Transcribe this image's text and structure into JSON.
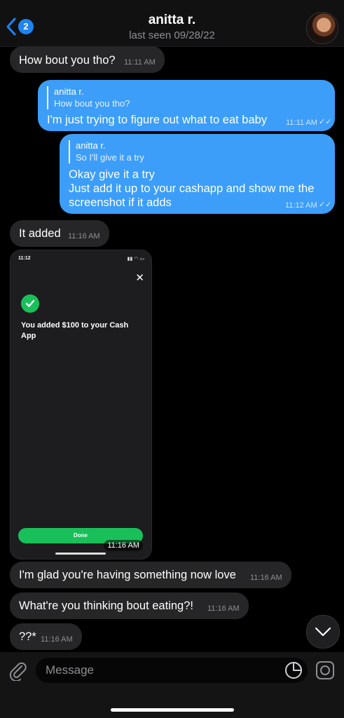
{
  "header": {
    "back_badge": "2",
    "contact_name": "anitta r.",
    "last_seen": "last seen 09/28/22"
  },
  "messages": [
    {
      "dir": "in",
      "text": "How bout you tho?",
      "time": "11:11 AM"
    },
    {
      "dir": "out",
      "reply_name": "anitta r.",
      "reply_text": "How bout you tho?",
      "text": "I'm just trying to figure out what to eat baby",
      "time": "11:11 AM"
    },
    {
      "dir": "out",
      "reply_name": "anitta r.",
      "reply_text": "So I'll give it a try",
      "lines": [
        "Okay give it a try",
        "Just add it up to your cashapp and show me the",
        "screenshot if it adds"
      ],
      "time": "11:12 AM"
    },
    {
      "dir": "in",
      "text": "It added",
      "time": "11:16 AM"
    },
    {
      "dir": "in",
      "text": "I'm glad you're having something now love",
      "time": "11:16 AM"
    },
    {
      "dir": "in",
      "text": "What're you thinking bout eating?!",
      "time": "11:16 AM"
    },
    {
      "dir": "in",
      "text": "??*",
      "time": "11:16 AM"
    }
  ],
  "screenshot_image": {
    "status_time": "11:12",
    "message": "You added $100 to your Cash App",
    "done_label": "Done",
    "time": "11:16 AM"
  },
  "composer": {
    "placeholder": "Message"
  },
  "colors": {
    "outgoing": "#3c9ef8",
    "incoming": "#262628",
    "accent": "#1e84f0",
    "cash_green": "#19c05a"
  }
}
